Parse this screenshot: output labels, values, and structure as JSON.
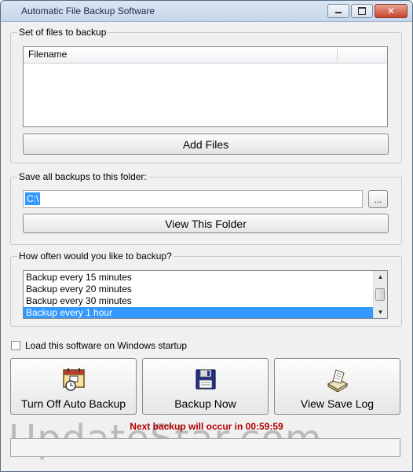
{
  "window": {
    "title": "Automatic File Backup Software"
  },
  "files_group": {
    "label": "Set of files to backup",
    "column_filename": "Filename",
    "add_files_label": "Add Files"
  },
  "folder_group": {
    "label": "Save all backups to this folder:",
    "folder_value": "C:\\",
    "browse_label": "...",
    "view_folder_label": "View This Folder"
  },
  "frequency_group": {
    "label": "How often would you like to backup?",
    "options": [
      {
        "label": "Backup every 15 minutes",
        "selected": false
      },
      {
        "label": "Backup every 20 minutes",
        "selected": false
      },
      {
        "label": "Backup every 30 minutes",
        "selected": false
      },
      {
        "label": "Backup every 1 hour",
        "selected": true
      }
    ]
  },
  "startup": {
    "label": "Load this software on Windows startup",
    "checked": false
  },
  "actions": {
    "turn_off_label": "Turn Off Auto Backup",
    "backup_now_label": "Backup Now",
    "view_log_label": "View Save Log"
  },
  "status": {
    "next_backup": "Next backup will occur in 00:59:59"
  },
  "watermark": "UpdateStar.com"
}
